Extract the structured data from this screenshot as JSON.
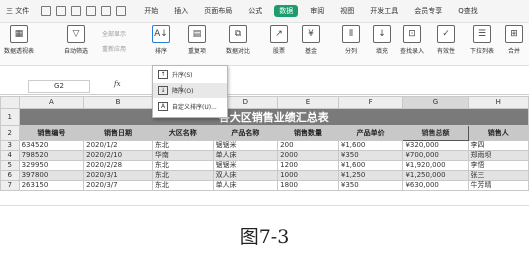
{
  "menubar": {
    "file": "三 文件",
    "items": [
      "开始",
      "插入",
      "页面布局",
      "公式",
      "数据",
      "审阅",
      "视图",
      "开发工具",
      "会员专享",
      "Q查找"
    ],
    "active_index": 4
  },
  "ribbon": {
    "pivot": "数据透视表",
    "autofilter": "自动筛选",
    "show_all": "全部显示",
    "reapply": "重新应用",
    "sort": "排序",
    "dup": "重复项",
    "compare": "数据对比",
    "stock": "股票",
    "fund": "基金",
    "split": "分列",
    "fill": "填充",
    "lookup": "查找录入",
    "validity": "有效性",
    "dropdown_list": "下拉列表",
    "merge": "合并"
  },
  "sort_menu": {
    "items": [
      "升序(S)",
      "降序(O)",
      "自定义排序(U)..."
    ],
    "highlight_index": 1
  },
  "formula_bar": {
    "cell_ref": "G2",
    "fx": "fx"
  },
  "sheet": {
    "columns": [
      "A",
      "B",
      "C",
      "D",
      "E",
      "F",
      "G",
      "H"
    ],
    "title": "各大区销售业绩汇总表",
    "headers": [
      "销售编号",
      "销售日期",
      "大区名称",
      "产品名称",
      "销售数量",
      "产品单价",
      "销售总额",
      "销售人"
    ],
    "rows": [
      [
        "634520",
        "2020/1/2",
        "东北",
        "锯锯米",
        "200",
        "¥1,600",
        "¥320,000",
        "李四"
      ],
      [
        "798520",
        "2020/2/10",
        "华南",
        "单人床",
        "2000",
        "¥350",
        "¥700,000",
        "郑雨坝"
      ],
      [
        "329950",
        "2020/2/28",
        "东北",
        "锯锯米",
        "1200",
        "¥1,600",
        "¥1,920,000",
        "李悟"
      ],
      [
        "397800",
        "2020/3/1",
        "东北",
        "双人床",
        "1000",
        "¥1,250",
        "¥1,250,000",
        "张三"
      ],
      [
        "263150",
        "2020/3/7",
        "东北",
        "单人床",
        "1800",
        "¥350",
        "¥630,000",
        "牛芳晴"
      ]
    ],
    "row_numbers": [
      "1",
      "2",
      "3",
      "4",
      "5",
      "6",
      "7"
    ]
  },
  "caption": "图7-3"
}
